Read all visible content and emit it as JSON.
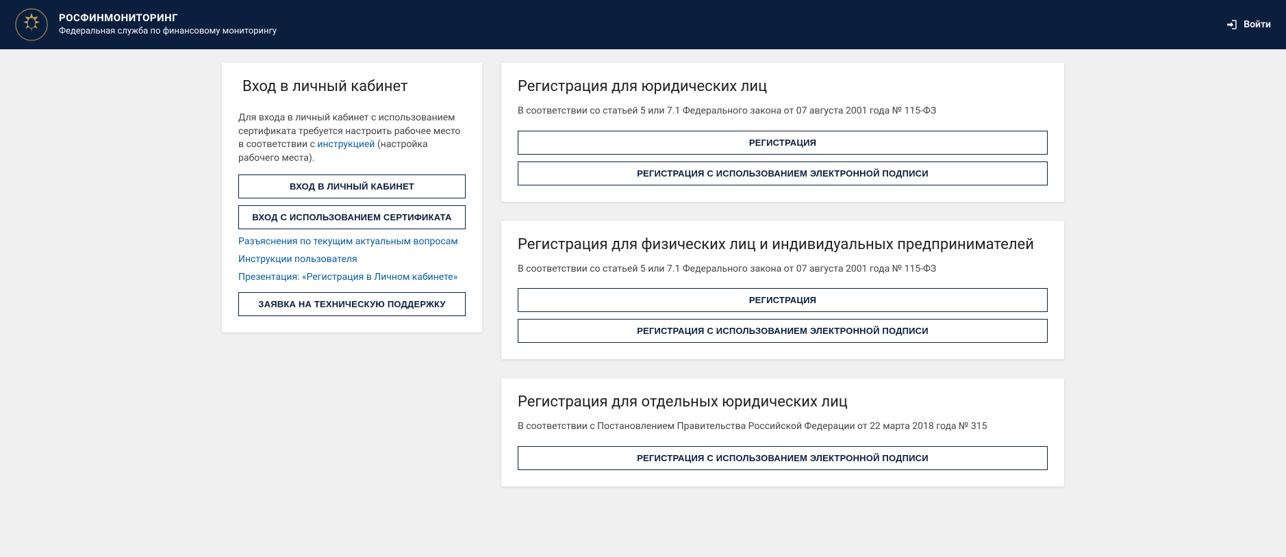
{
  "header": {
    "title": "РОСФИНМОНИТОРИНГ",
    "subtitle": "Федеральная служба по финансовому мониторингу",
    "login": "Войти"
  },
  "login_card": {
    "title": "Вход в личный кабинет",
    "desc_before": "Для входа в личный кабинет с использованием сертификата требуется настроить рабочее место в соответствии с ",
    "instruction_link": "инструкцией",
    "desc_after": " (настройка рабочего места).",
    "btn_login": "ВХОД В ЛИЧНЫЙ КАБИНЕТ",
    "btn_cert": "ВХОД С ИСПОЛЬЗОВАНИЕМ СЕРТИФИКАТА",
    "link_faq": "Разъяснения по текущим актуальным вопросам",
    "link_manual": "Инструкции пользователя",
    "link_presentation": "Презентация: «Регистрация в Личном кабинете»",
    "btn_support": "ЗАЯВКА НА ТЕХНИЧЕСКУЮ ПОДДЕРЖКУ"
  },
  "reg_legal": {
    "title": "Регистрация для юридических лиц",
    "desc": "В соответствии со статьей 5 или 7.1 Федерального закона от 07 августа 2001 года № 115-ФЗ",
    "btn_reg": "РЕГИСТРАЦИЯ",
    "btn_reg_sig": "РЕГИСТРАЦИЯ С ИСПОЛЬЗОВАНИЕМ ЭЛЕКТРОННОЙ ПОДПИСИ"
  },
  "reg_individual": {
    "title": "Регистрация для физических лиц и индивидуальных предпринимателей",
    "desc": "В соответствии со статьей 5 или 7.1 Федерального закона от 07 августа 2001 года № 115-ФЗ",
    "btn_reg": "РЕГИСТРАЦИЯ",
    "btn_reg_sig": "РЕГИСТРАЦИЯ С ИСПОЛЬЗОВАНИЕМ ЭЛЕКТРОННОЙ ПОДПИСИ"
  },
  "reg_special": {
    "title": "Регистрация для отдельных юридических лиц",
    "desc": "В соответствии с Постановлением Правительства Российской Федерации от 22 марта 2018 года № 315",
    "btn_reg_sig": "РЕГИСТРАЦИЯ С ИСПОЛЬЗОВАНИЕМ ЭЛЕКТРОННОЙ ПОДПИСИ"
  }
}
